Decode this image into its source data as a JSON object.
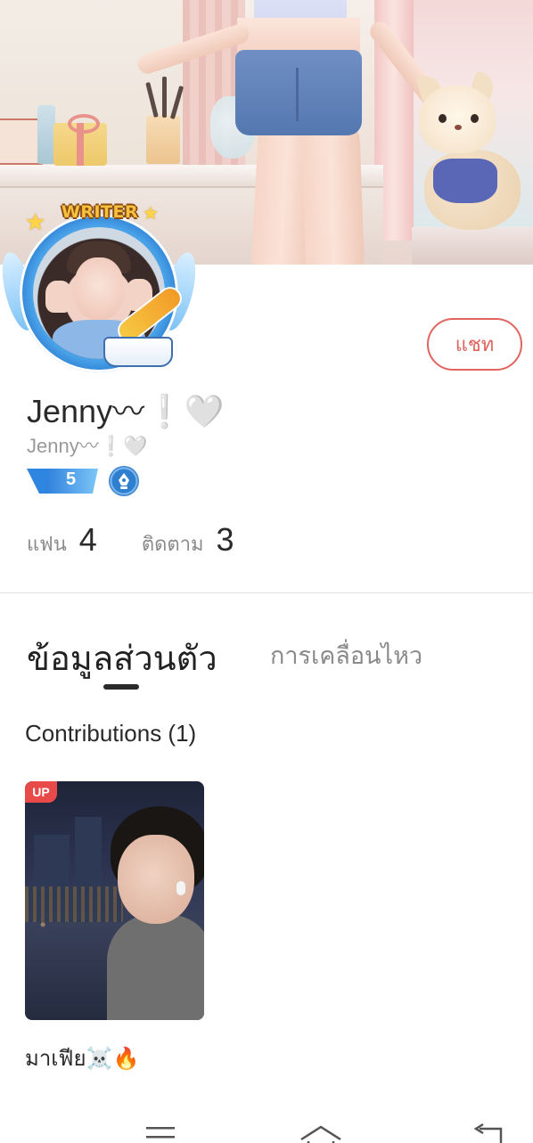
{
  "profile": {
    "display_name": "Jenny〰❕🤍",
    "username": "Jenny〰❕🤍",
    "avatar_badge": "WRITER",
    "level": "5",
    "chat_button": "แชท"
  },
  "stats": {
    "fans_label": "แฟน",
    "fans_count": "4",
    "following_label": "ติดตาม",
    "following_count": "3"
  },
  "tabs": {
    "active": "ข้อมูลส่วนตัว",
    "inactive": "การเคลื่อนไหว"
  },
  "contributions": {
    "title": "Contributions (1)",
    "items": [
      {
        "badge": "UP",
        "caption": "มาเฟีย☠️🔥"
      }
    ]
  },
  "nav": {
    "icons": [
      "menu-icon",
      "home-icon",
      "back-icon"
    ]
  },
  "colors": {
    "accent": "#e2645e",
    "badge_red": "#e84a4a",
    "level_blue": "#3e9be6"
  }
}
